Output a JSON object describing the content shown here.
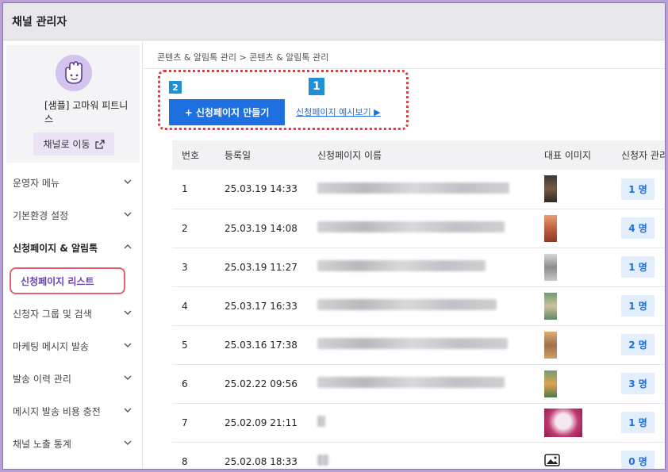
{
  "window": {
    "title": "채널 관리자"
  },
  "profile": {
    "name": "[샘플] 고마워 피트니스",
    "goto_label": "채널로 이동"
  },
  "sidebar": {
    "items": [
      {
        "label": "운영자 메뉴",
        "expanded": false
      },
      {
        "label": "기본환경 설정",
        "expanded": false
      },
      {
        "label": "신청페이지 & 알림톡",
        "expanded": true
      },
      {
        "label": "신청자 그룹 및 검색",
        "expanded": false
      },
      {
        "label": "마케팅 메시지 발송",
        "expanded": false
      },
      {
        "label": "발송 이력 관리",
        "expanded": false
      },
      {
        "label": "메시지 발송 비용 충전",
        "expanded": false
      },
      {
        "label": "채널 노출 통계",
        "expanded": false
      }
    ],
    "active_sub": "신청페이지 리스트"
  },
  "breadcrumb": "콘텐츠 & 알림톡 관리 > 콘텐츠 & 알림톡 관리",
  "badges": {
    "one": "1",
    "two": "2"
  },
  "actions": {
    "create_label": "+ 신청페이지 만들기",
    "preview_label": "신청페이지 예시보기 ▶"
  },
  "colors": {
    "accent": "#1e6fe0",
    "highlight": "#e0393f",
    "brand": "#6a3fb0"
  },
  "table": {
    "headers": [
      "번호",
      "등록일",
      "신청페이지 이름",
      "대표 이미지",
      "신청자 관리"
    ],
    "rows": [
      {
        "no": "1",
        "date": "25.03.19 14:33",
        "count": "1 명"
      },
      {
        "no": "2",
        "date": "25.03.19 14:08",
        "count": "4 명"
      },
      {
        "no": "3",
        "date": "25.03.19 11:27",
        "count": "1 명"
      },
      {
        "no": "4",
        "date": "25.03.17 16:33",
        "count": "1 명"
      },
      {
        "no": "5",
        "date": "25.03.16 17:38",
        "count": "2 명"
      },
      {
        "no": "6",
        "date": "25.02.22 09:56",
        "count": "3 명"
      },
      {
        "no": "7",
        "date": "25.02.09 21:11",
        "count": "1 명"
      },
      {
        "no": "8",
        "date": "25.02.08 18:33",
        "count": "0 명"
      }
    ]
  }
}
